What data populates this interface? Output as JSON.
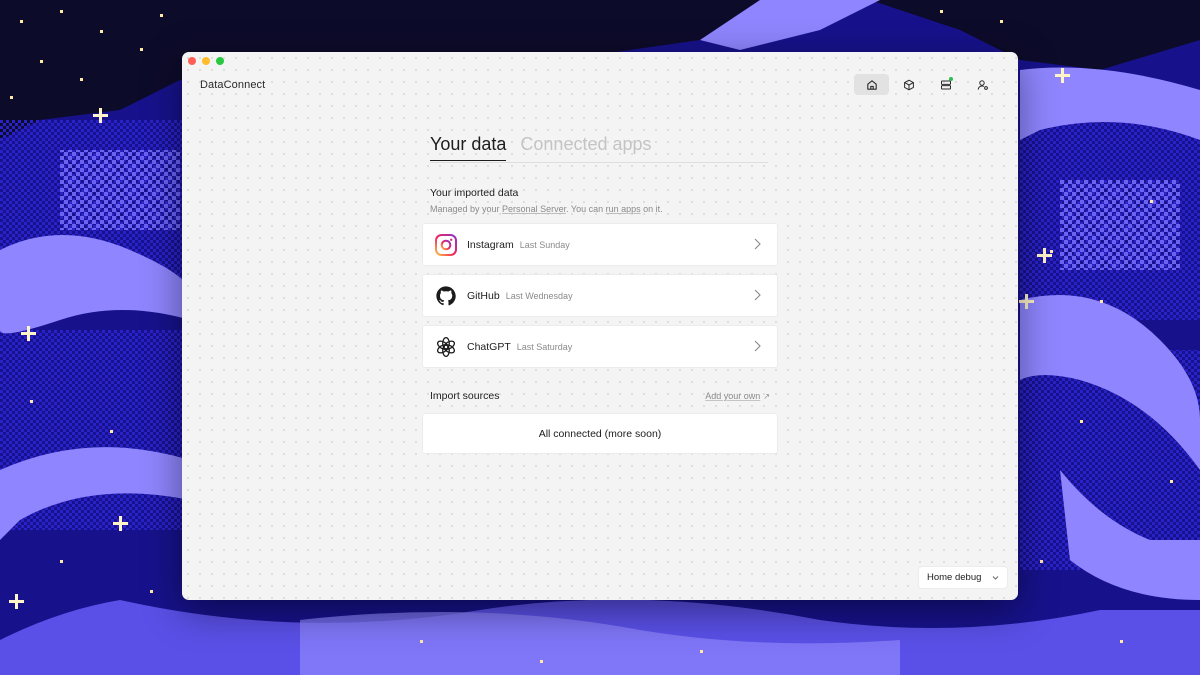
{
  "app": {
    "title": "DataConnect"
  },
  "topnav": {
    "items": [
      {
        "icon": "home-icon",
        "active": true
      },
      {
        "icon": "cube-icon",
        "active": false
      },
      {
        "icon": "server-icon",
        "active": false,
        "status": "online"
      },
      {
        "icon": "user-settings-icon",
        "active": false
      }
    ]
  },
  "tabs": [
    {
      "label": "Your data",
      "active": true
    },
    {
      "label": "Connected apps",
      "active": false
    }
  ],
  "imported": {
    "title": "Your imported data",
    "subtitle_prefix": "Managed by your ",
    "subtitle_link1": "Personal Server",
    "subtitle_mid": ". You can ",
    "subtitle_link2": "run apps",
    "subtitle_suffix": " on it.",
    "items": [
      {
        "name": "Instagram",
        "date": "Last Sunday",
        "icon": "instagram-icon"
      },
      {
        "name": "GitHub",
        "date": "Last Wednesday",
        "icon": "github-icon"
      },
      {
        "name": "ChatGPT",
        "date": "Last Saturday",
        "icon": "chatgpt-icon"
      }
    ]
  },
  "sources": {
    "title": "Import sources",
    "add_label": "Add your own",
    "add_arrow": "↗",
    "empty_text": "All connected (more soon)"
  },
  "debug": {
    "selected": "Home debug"
  },
  "colors": {
    "window_bg": "#f4f4f4",
    "status_online": "#2fbf4f",
    "background_navy": "#14107a",
    "background_lavender": "#8f86ff"
  }
}
